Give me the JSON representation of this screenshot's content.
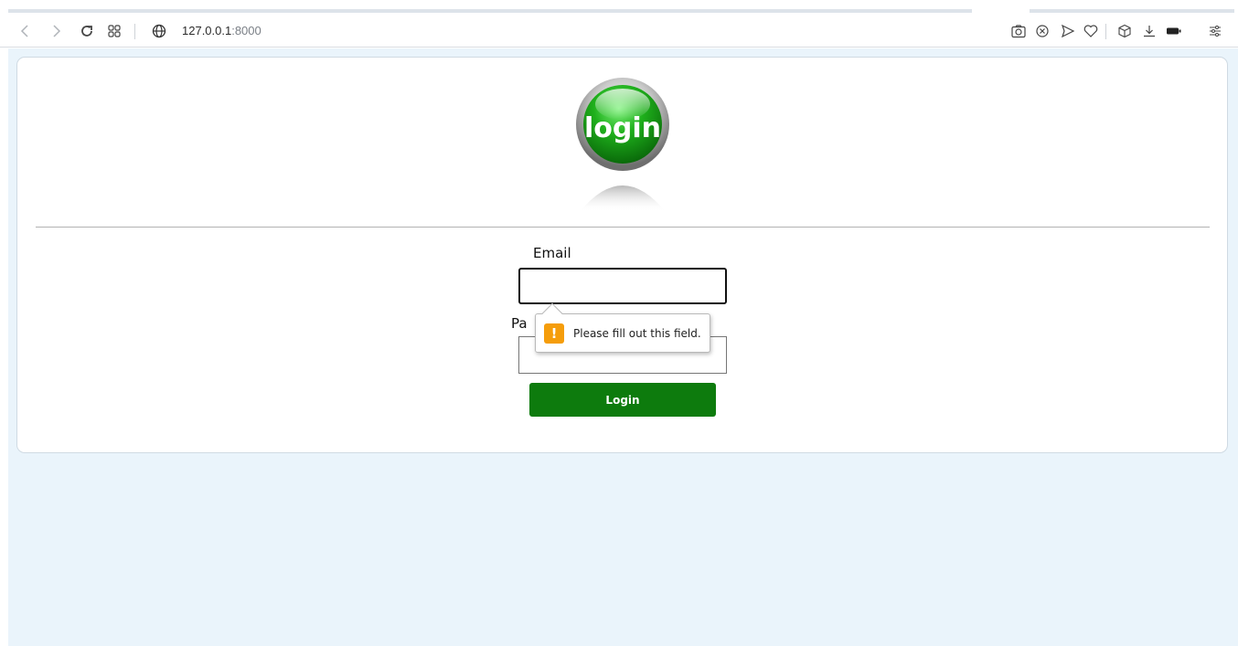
{
  "browser": {
    "url_host": "127.0.0.1",
    "url_port": ":8000",
    "nav_icons": [
      "back-icon",
      "forward-icon",
      "reload-icon",
      "tabs-grid-icon",
      "globe-icon"
    ],
    "toolbar_icons": [
      "camera-icon",
      "shield-block-icon",
      "send-icon",
      "heart-icon",
      "cube-icon",
      "download-icon",
      "battery-icon",
      "menu-icon"
    ]
  },
  "page": {
    "logo_text": "login",
    "email_label": "Email",
    "email_value": "",
    "password_label": "Pa",
    "password_value": "",
    "login_button": "Login",
    "validation_message": "Please fill out this field.",
    "validation_icon": "!"
  },
  "colors": {
    "page_background": "#eaf4fb",
    "button_green": "#0d7b0d",
    "warning_orange": "#f59d0b"
  }
}
